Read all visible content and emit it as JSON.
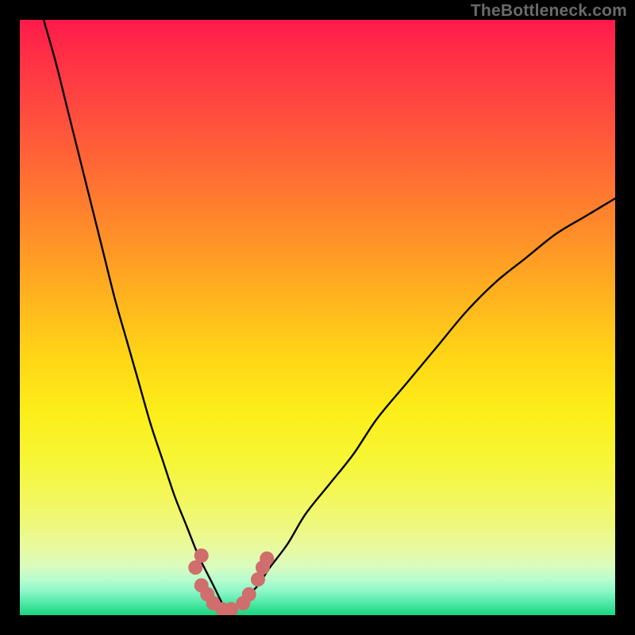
{
  "watermark": "TheBottleneck.com",
  "chart_data": {
    "type": "line",
    "title": "",
    "xlabel": "",
    "ylabel": "",
    "xlim": [
      0,
      100
    ],
    "ylim": [
      0,
      100
    ],
    "note": "Background colors encode a bottleneck severity gradient (red = severe, green = optimal). Two curves fall from the top toward a minimum near x≈34 then rise again; the right curve extends to the right edge. A cluster of salmon-colored markers sits at the valley floor.",
    "series": [
      {
        "name": "left-curve",
        "x": [
          4,
          6,
          8,
          10,
          12,
          14,
          16,
          18,
          20,
          22,
          24,
          26,
          28,
          30,
          32,
          33,
          34,
          35,
          36
        ],
        "y": [
          100,
          93,
          85,
          77,
          69,
          61,
          53,
          46,
          39,
          32,
          26,
          20,
          15,
          10,
          6,
          4,
          2,
          1,
          0
        ]
      },
      {
        "name": "right-curve",
        "x": [
          34,
          36,
          38,
          40,
          42,
          45,
          48,
          52,
          56,
          60,
          65,
          70,
          75,
          80,
          85,
          90,
          95,
          100
        ],
        "y": [
          0,
          1,
          3,
          5,
          8,
          12,
          17,
          22,
          27,
          33,
          39,
          45,
          51,
          56,
          60,
          64,
          67,
          70
        ]
      }
    ],
    "markers": {
      "name": "valley-markers",
      "color": "#cf6e6c",
      "points": [
        {
          "x": 29.5,
          "y": 8
        },
        {
          "x": 30.5,
          "y": 5
        },
        {
          "x": 30.5,
          "y": 10
        },
        {
          "x": 31.5,
          "y": 3.5
        },
        {
          "x": 32.5,
          "y": 2
        },
        {
          "x": 34,
          "y": 1
        },
        {
          "x": 35.5,
          "y": 1
        },
        {
          "x": 37.5,
          "y": 2
        },
        {
          "x": 38.5,
          "y": 3.5
        },
        {
          "x": 40,
          "y": 6
        },
        {
          "x": 40.8,
          "y": 8
        },
        {
          "x": 41.5,
          "y": 9.5
        }
      ]
    }
  }
}
